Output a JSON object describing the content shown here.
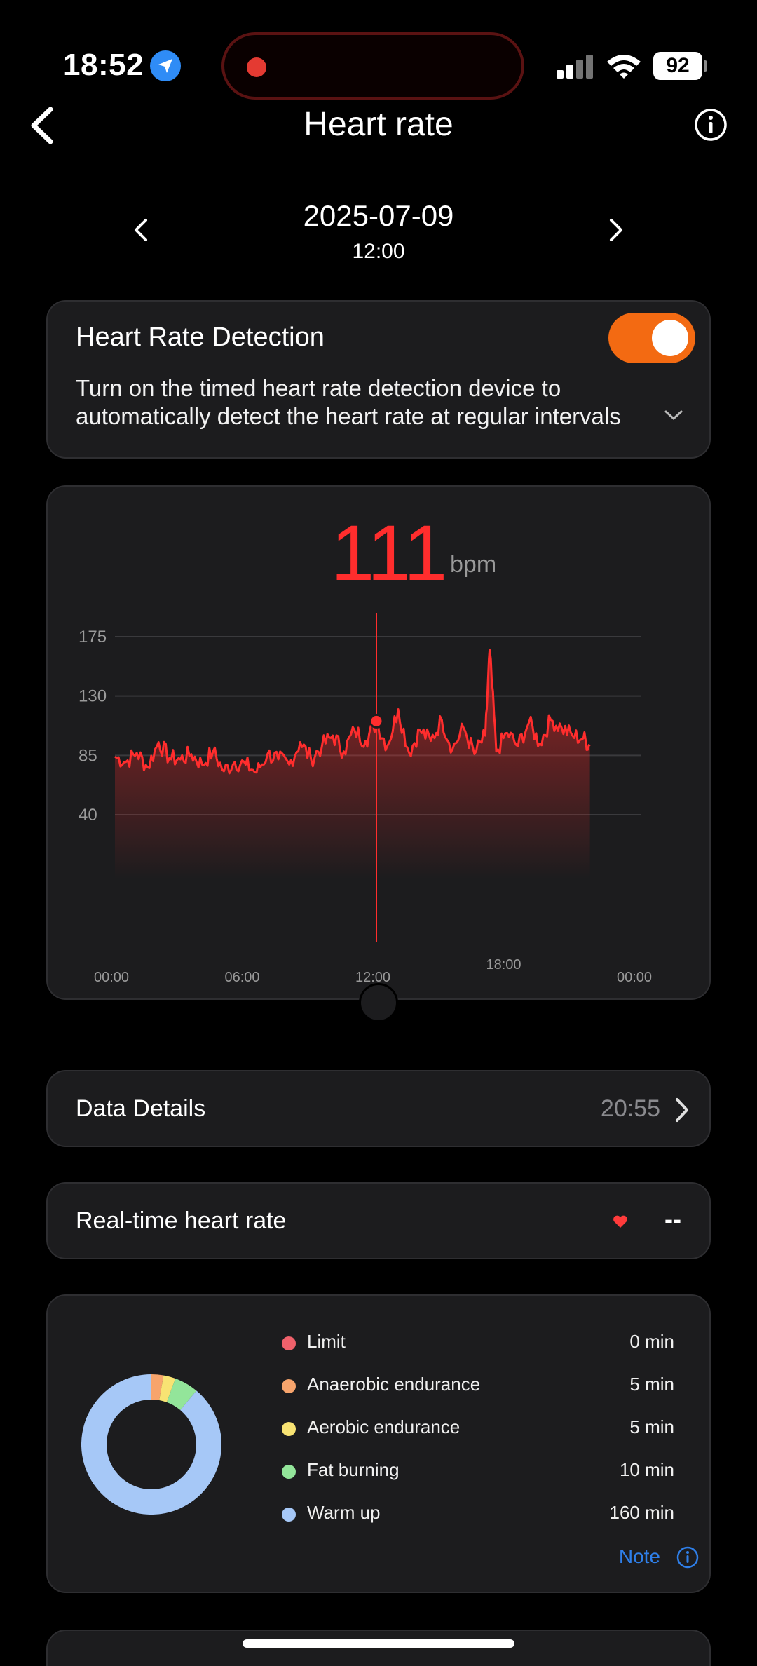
{
  "status_bar": {
    "time": "18:52",
    "battery": "92",
    "icons": [
      "location-arrow-icon",
      "cellular-signal-icon",
      "wifi-icon",
      "battery-icon"
    ]
  },
  "header": {
    "title": "Heart rate",
    "back_icon": "chevron-left-icon",
    "info_icon": "info-circle-icon"
  },
  "date_nav": {
    "date": "2025-07-09",
    "time": "12:00"
  },
  "detection": {
    "title": "Heart Rate Detection",
    "enabled": true,
    "desc_line1": "Turn on the timed heart rate detection device to",
    "desc_line2": "automatically detect the heart rate at regular intervals"
  },
  "readout": {
    "value": "111",
    "unit": "bpm"
  },
  "chart_data": {
    "type": "area",
    "ylim": [
      40,
      175
    ],
    "y_ticks": [
      "175",
      "130",
      "85",
      "40"
    ],
    "x_ticks": [
      "00:00",
      "06:00",
      "12:00",
      "18:00",
      "00:00"
    ],
    "selected": {
      "x": "12:00",
      "y": 111
    },
    "series": [
      {
        "x_hours": [
          0,
          0.5,
          1,
          1.5,
          2,
          2.5,
          3,
          3.5,
          4,
          4.5,
          5,
          5.5,
          6,
          6.5,
          7,
          7.5,
          8,
          8.5,
          9,
          9.5,
          10,
          10.5,
          11,
          11.5,
          12,
          12.5,
          13,
          13.5,
          14,
          14.5,
          15,
          15.5,
          16,
          16.5,
          17,
          17.2,
          17.5,
          18,
          18.5,
          19,
          19.5,
          20,
          20.5,
          21,
          21.5,
          21.8
        ],
        "values": [
          84,
          80,
          87,
          76,
          95,
          83,
          82,
          86,
          78,
          88,
          73,
          80,
          78,
          72,
          86,
          82,
          78,
          95,
          82,
          92,
          100,
          88,
          104,
          96,
          110,
          92,
          120,
          87,
          104,
          96,
          112,
          90,
          106,
          86,
          100,
          165,
          88,
          102,
          92,
          110,
          94,
          112,
          106,
          100,
          98,
          92
        ]
      }
    ]
  },
  "details": {
    "label": "Data Details",
    "time": "20:55"
  },
  "realtime": {
    "label": "Real-time heart rate",
    "value": "--"
  },
  "zones": {
    "items": [
      {
        "name": "Limit",
        "value": "0 min",
        "color": "#f0616b",
        "minutes": 0
      },
      {
        "name": "Anaerobic endurance",
        "value": "5 min",
        "color": "#f7a46c",
        "minutes": 5
      },
      {
        "name": "Aerobic endurance",
        "value": "5 min",
        "color": "#f8e373",
        "minutes": 5
      },
      {
        "name": "Fat burning",
        "value": "10 min",
        "color": "#93e59a",
        "minutes": 10
      },
      {
        "name": "Warm up",
        "value": "160 min",
        "color": "#a6c8f7",
        "minutes": 160
      }
    ],
    "note": "Note"
  },
  "colors": {
    "accent": "#f36a12",
    "heart_line": "#ff2d2d",
    "link": "#2f7fe8"
  }
}
